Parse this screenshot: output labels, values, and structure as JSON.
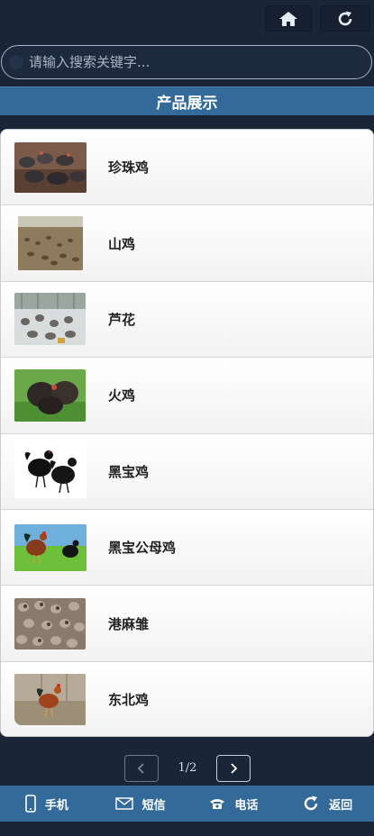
{
  "topbar": {
    "home_icon": "home-icon",
    "refresh_icon": "refresh-icon"
  },
  "search": {
    "placeholder": "请输入搜索关键字..."
  },
  "section": {
    "title": "产品展示"
  },
  "products": [
    {
      "name": "珍珠鸡",
      "image": "guinea-fowl-flock-photo"
    },
    {
      "name": "山鸡",
      "image": "pheasant-farm-photo"
    },
    {
      "name": "芦花",
      "image": "barred-chicken-flock-photo"
    },
    {
      "name": "火鸡",
      "image": "turkey-photo"
    },
    {
      "name": "黑宝鸡",
      "image": "black-chicken-photo"
    },
    {
      "name": "黑宝公母鸡",
      "image": "rooster-and-hen-photo"
    },
    {
      "name": "港麻雏",
      "image": "chicks-photo"
    },
    {
      "name": "东北鸡",
      "image": "rooster-on-ground-photo"
    }
  ],
  "pager": {
    "page_info": "1/2",
    "prev_icon": "chevron-left-icon",
    "next_icon": "chevron-right-icon"
  },
  "bottom_nav": [
    {
      "label": "手机",
      "icon": "mobile-phone-icon"
    },
    {
      "label": "短信",
      "icon": "envelope-icon"
    },
    {
      "label": "电话",
      "icon": "telephone-icon"
    },
    {
      "label": "返回",
      "icon": "back-refresh-icon"
    }
  ]
}
